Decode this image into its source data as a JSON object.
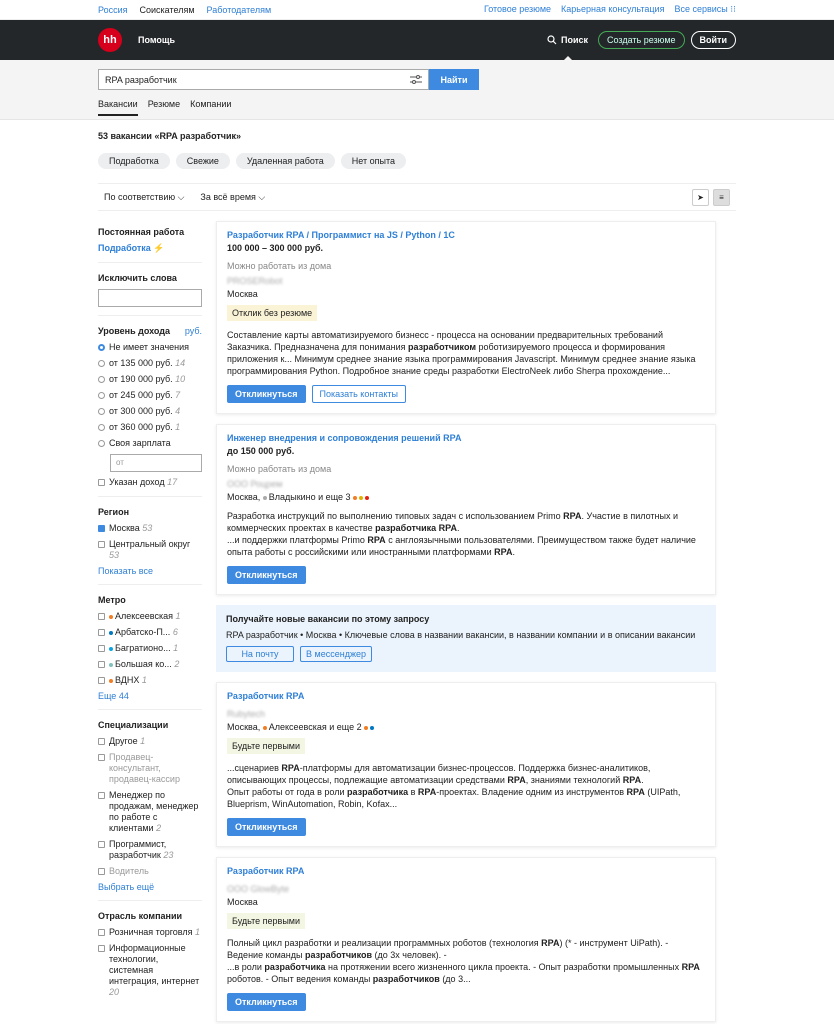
{
  "top": {
    "left": [
      "Россия",
      "Соискателям",
      "Работодателям"
    ],
    "right": [
      "Готовое резюме",
      "Карьерная консультация",
      "Все сервисы ⁝⁝"
    ]
  },
  "header": {
    "logo": "hh",
    "help": "Помощь",
    "search": "Поиск",
    "create": "Создать резюме",
    "login": "Войти"
  },
  "search": {
    "query": "RPA разработчик",
    "find": "Найти",
    "tabs": [
      "Вакансии",
      "Резюме",
      "Компании"
    ]
  },
  "count": "53 вакансии «RPA разработчик»",
  "chips": [
    "Подработка",
    "Свежие",
    "Удаленная работа",
    "Нет опыта"
  ],
  "sort": {
    "relevance": "По соответствию ⌵",
    "period": "За всё время ⌵"
  },
  "side": {
    "perm": "Постоянная работа",
    "part": "Подработка",
    "exclude": "Исключить слова",
    "income": "Уровень дохода",
    "income_cur": "руб.",
    "income_opts": [
      {
        "l": "Не имеет значения",
        "c": ""
      },
      {
        "l": "от 135 000 руб.",
        "c": "14"
      },
      {
        "l": "от 190 000 руб.",
        "c": "10"
      },
      {
        "l": "от 245 000 руб.",
        "c": "7"
      },
      {
        "l": "от 300 000 руб.",
        "c": "4"
      },
      {
        "l": "от 360 000 руб.",
        "c": "1"
      },
      {
        "l": "Своя зарплата",
        "c": ""
      }
    ],
    "from": "от",
    "income_spec": "Указан доход",
    "income_spec_c": "17",
    "region": "Регион",
    "moscow": "Москва",
    "moscow_c": "53",
    "central": "Центральный округ",
    "central_c": "53",
    "show_all": "Показать все",
    "metro": "Метро",
    "metro_items": [
      {
        "l": "Алексеевская",
        "c": "1",
        "col": "#f07e24"
      },
      {
        "l": "Арбатско-П...",
        "c": "6",
        "col": "#0078be"
      },
      {
        "l": "Багратионо...",
        "c": "1",
        "col": "#09a5e0"
      },
      {
        "l": "Большая ко...",
        "c": "2",
        "col": "#82c0c0"
      },
      {
        "l": "ВДНХ",
        "c": "1",
        "col": "#f07e24"
      }
    ],
    "more44": "Еще 44",
    "spec": "Специализации",
    "sp1": "Другое",
    "sp1c": "1",
    "sp2": "Продавец-консультант, продавец-кассир",
    "sp3": "Менеджер по продажам, менеджер по работе с клиентами",
    "sp3c": "2",
    "sp4": "Программист, разработчик",
    "sp4c": "23",
    "sp5": "Водитель",
    "choose": "Выбрать ещё",
    "ind": "Отрасль компании",
    "in1": "Розничная торговля",
    "in1c": "1",
    "in2": "Информационные технологии, системная интеграция, интернет",
    "in2c": "20"
  },
  "v1": {
    "title": "Разработчик RPA / Программист на JS / Python / 1С",
    "salary": "100 000 – 300 000 руб.",
    "remote": "Можно работать из дома",
    "company": "PROSERobot",
    "city": "Москва",
    "tag": "Отклик без резюме",
    "apply": "Откликнуться",
    "contacts": "Показать контакты"
  },
  "v2": {
    "title": "Инженер внедрения и сопровождения решений RPA",
    "salary": "до 150 000 руб.",
    "remote": "Можно работать из дома",
    "company": "ООО Роцрем",
    "city": "Москва, ",
    "metro": "Владыкино и еще 3",
    "apply": "Откликнуться"
  },
  "promo": {
    "title": "Получайте новые вакансии по этому запросу",
    "desc": "RPA разработчик • Москва • Ключевые слова в названии вакансии, в названии компании и в описании вакансии",
    "mail": "На почту",
    "msg": "В мессенджер"
  },
  "v3": {
    "title": "Разработчик RPA",
    "company": "Rubytech",
    "city": "Москва, ",
    "metro": "Алексеевская и еще 2",
    "tag": "Будьте первыми",
    "apply": "Откликнуться"
  },
  "v4": {
    "title": "Разработчик RPA",
    "company": "ООО GlowByte",
    "city": "Москва",
    "tag": "Будьте первыми",
    "apply": "Откликнуться"
  }
}
